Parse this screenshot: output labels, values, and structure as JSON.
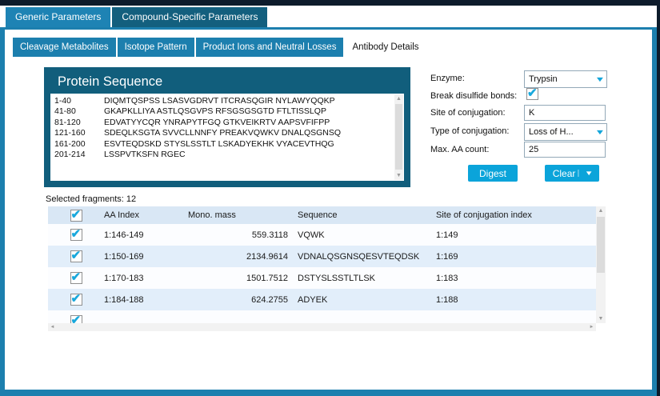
{
  "top_tabs": [
    {
      "label": "Generic Parameters",
      "active": false
    },
    {
      "label": "Compound-Specific Parameters",
      "active": true
    }
  ],
  "sub_tabs": [
    {
      "label": "Cleavage Metabolites",
      "active": false
    },
    {
      "label": "Isotope Pattern",
      "active": false
    },
    {
      "label": "Product Ions and Neutral Losses",
      "active": false
    },
    {
      "label": "Antibody Details",
      "active": true
    }
  ],
  "protein_sequence": {
    "title": "Protein Sequence",
    "rows": [
      {
        "range": "1-40",
        "seq": "DIQMTQSPSS LSASVGDRVT ITCRASQGIR NYLAWYQQKP"
      },
      {
        "range": "41-80",
        "seq": "GKAPKLLIYA ASTLQSGVPS RFSGSGSGTD FTLTISSLQP"
      },
      {
        "range": "81-120",
        "seq": "EDVATYYCQR YNRAPYTFGQ GTKVEIKRTV AAPSVFIFPP"
      },
      {
        "range": "121-160",
        "seq": "SDEQLKSGTA SVVCLLNNFY PREAKVQWKV DNALQSGNSQ"
      },
      {
        "range": "161-200",
        "seq": "ESVTEQDSKD STYSLSSTLT LSKADYEKHK VYACEVTHQG"
      },
      {
        "range": "201-214",
        "seq": "LSSPVTKSFN RGEC"
      }
    ]
  },
  "form": {
    "enzyme": {
      "label": "Enzyme:",
      "value": "Trypsin"
    },
    "break_disulfide": {
      "label": "Break disulfide bonds:",
      "checked": true
    },
    "site_of_conjugation": {
      "label": "Site of conjugation:",
      "value": "K"
    },
    "type_of_conjugation": {
      "label": "Type of conjugation:",
      "value": "Loss of H..."
    },
    "max_aa_count": {
      "label": "Max. AA count:",
      "value": "25"
    },
    "digest_button": "Digest",
    "clear_button": "Clear"
  },
  "fragments": {
    "selected_label": "Selected fragments: 12",
    "select_all_checked": true,
    "columns": [
      "AA Index",
      "Mono. mass",
      "Sequence",
      "Site of conjugation index"
    ],
    "rows": [
      {
        "checked": true,
        "aa_index": "1:146-149",
        "mono_mass": "559.3118",
        "sequence": "VQWK",
        "site_of_conjugation_index": "1:149"
      },
      {
        "checked": true,
        "aa_index": "1:150-169",
        "mono_mass": "2134.9614",
        "sequence": "VDNALQSGNSQESVTEQDSK",
        "site_of_conjugation_index": "1:169"
      },
      {
        "checked": true,
        "aa_index": "1:170-183",
        "mono_mass": "1501.7512",
        "sequence": "DSTYSLSSTLTLSK",
        "site_of_conjugation_index": "1:183"
      },
      {
        "checked": true,
        "aa_index": "1:184-188",
        "mono_mass": "624.2755",
        "sequence": "ADYEK",
        "site_of_conjugation_index": "1:188"
      }
    ],
    "partial_row_checked": true
  },
  "colors": {
    "accent_teal": "#1c7fae",
    "dark_teal": "#115e7c",
    "button_blue": "#0ba4da",
    "check_blue": "#19a8dc",
    "table_header_bg": "#d9e7f5",
    "table_alt_row_bg": "#e2eefa"
  }
}
